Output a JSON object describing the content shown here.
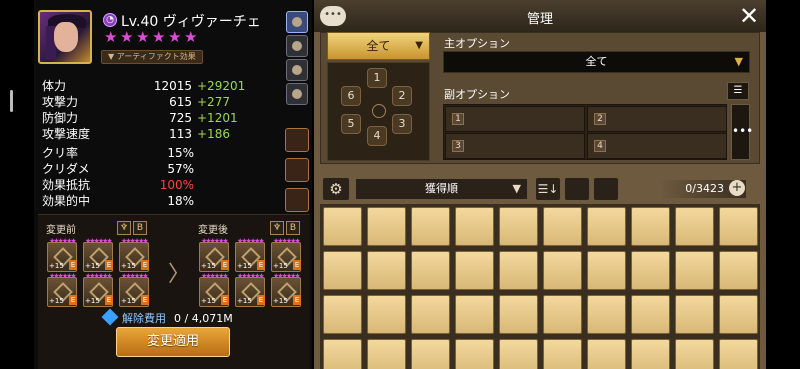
{
  "hero": {
    "level_name": "Lv.40 ヴィヴァーチェ",
    "element": "dark",
    "element_glyph": "◔",
    "stars": 6,
    "artifact_label": "▼ アーティファクト効果"
  },
  "stats": [
    {
      "label": "体力",
      "base": "12015",
      "bonus": "+29201"
    },
    {
      "label": "攻撃力",
      "base": "615",
      "bonus": "+277"
    },
    {
      "label": "防御力",
      "base": "725",
      "bonus": "+1201"
    },
    {
      "label": "攻撃速度",
      "base": "113",
      "bonus": "+186"
    }
  ],
  "rates": [
    {
      "label": "クリ率",
      "value": "15%",
      "highlight": false
    },
    {
      "label": "クリダメ",
      "value": "57%",
      "highlight": false
    },
    {
      "label": "効果抵抗",
      "value": "100%",
      "highlight": true
    },
    {
      "label": "効果的中",
      "value": "18%",
      "highlight": false
    }
  ],
  "preview": {
    "before_label": "変更前",
    "after_label": "変更後",
    "header_icons": [
      "♆",
      "B"
    ],
    "rune_plus": "+15",
    "rune_grade": "E",
    "arrow": "〉",
    "cost_label": "解除費用",
    "cost_value": "0 / 4,071M",
    "apply_label": "変更適用"
  },
  "manage": {
    "chat_glyph": "•••",
    "title": "管理",
    "close_glyph": "✕",
    "all_label": "全て",
    "dropdown_glyph": "▼",
    "slots": [
      "1",
      "2",
      "3",
      "4",
      "5",
      "6"
    ],
    "main_option_label": "主オプション",
    "main_option_value": "全て",
    "sub_option_label": "副オプション",
    "sub_toggle_glyph": "☰",
    "sub_slots": [
      "1",
      "2",
      "3",
      "4"
    ],
    "more_glyph": "•••",
    "gear_glyph": "⚙",
    "sort_label": "獲得順",
    "sort_order_glyph": "☰↓",
    "count": "0/3423",
    "add_glyph": "+"
  },
  "colors": {
    "accent_gold": "#e8a63a",
    "bonus_green": "#9bd84a",
    "highlight_red": "#ff4040",
    "star_pink": "#e04ad8"
  }
}
